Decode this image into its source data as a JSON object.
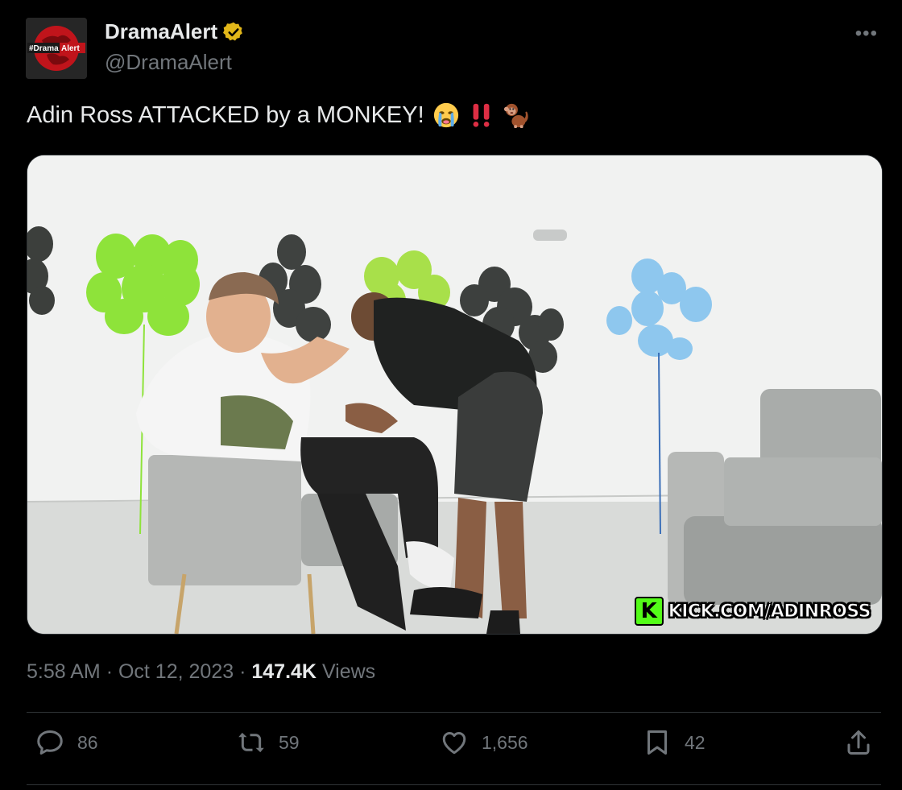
{
  "author": {
    "display_name": "DramaAlert",
    "handle": "@DramaAlert",
    "verified": true,
    "avatar_text_left": "#Drama",
    "avatar_text_right": "Alert"
  },
  "tweet": {
    "text": "Adin Ross ATTACKED by a MONKEY!",
    "emojis": [
      "crying-face",
      "double-exclamation",
      "monkey"
    ]
  },
  "media": {
    "watermark": "KICK.COM/ADINROSS",
    "watermark_logo": "K",
    "brand_color": "#53fc18"
  },
  "meta": {
    "time": "5:58 AM",
    "separator": "·",
    "date": "Oct 12, 2023",
    "views_count": "147.4K",
    "views_label": "Views"
  },
  "actions": {
    "replies": "86",
    "retweets": "59",
    "likes": "1,656",
    "bookmarks": "42"
  },
  "colors": {
    "background": "#000000",
    "text_primary": "#e7e9ea",
    "text_secondary": "#71767b",
    "border": "#2f3336",
    "verified_gold": "#e2b719"
  }
}
